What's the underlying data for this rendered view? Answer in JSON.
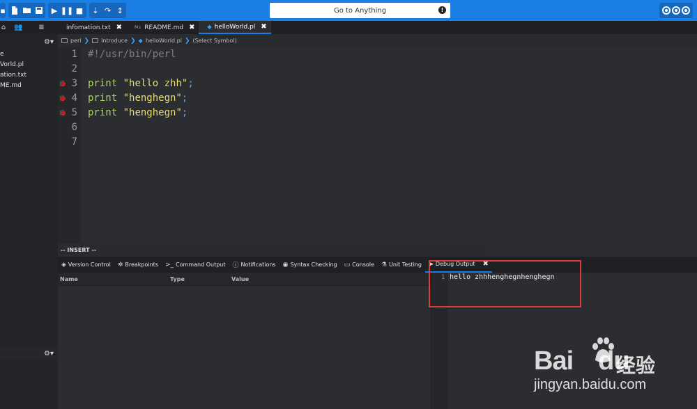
{
  "toolbar": {
    "goto_placeholder": "Go to Anything",
    "icons": [
      "new-file-icon",
      "open-folder-icon",
      "save-icon",
      "play-icon",
      "pause-icon",
      "stop-icon",
      "step-in-icon",
      "step-over-icon",
      "step-out-icon"
    ],
    "accent": "#1a7fe4"
  },
  "sidebar": {
    "tree": [
      "e",
      "Vorld.pl",
      "ation.txt",
      "ME.md"
    ]
  },
  "editor_tabs": [
    {
      "label": "infomation.txt",
      "close": "✖"
    },
    {
      "label": "README.md",
      "close": "✖",
      "badge": "M↓"
    },
    {
      "label": "helloWorld.pl",
      "close": "✖",
      "active": true
    }
  ],
  "breadcrumb": [
    "perl",
    "Introduce",
    "helloWorld.pl",
    "(Select Symbol)"
  ],
  "code": {
    "line_numbers": [
      "1",
      "2",
      "3",
      "4",
      "5",
      "6",
      "7"
    ],
    "shebang": "#!/usr/bin/perl",
    "lines": [
      {
        "kw": "print",
        "str": "\"hello zhh\"",
        "end": ";"
      },
      {
        "kw": "print",
        "str": "\"henghegn\"",
        "end": ";"
      },
      {
        "kw": "print",
        "str": "\"henghegn\"",
        "end": ";"
      }
    ]
  },
  "status": {
    "mode": "-- INSERT --"
  },
  "panel_tabs": [
    {
      "label": "Version Control",
      "icon": "version-control-icon"
    },
    {
      "label": "Breakpoints",
      "icon": "bug-icon"
    },
    {
      "label": "Command Output",
      "icon": "terminal-icon"
    },
    {
      "label": "Notifications",
      "icon": "info-icon"
    },
    {
      "label": "Syntax Checking",
      "icon": "eye-icon"
    },
    {
      "label": "Console",
      "icon": "monitor-icon"
    },
    {
      "label": "Unit Testing",
      "icon": "flask-icon"
    },
    {
      "label": "Debug Output",
      "icon": "play-icon",
      "active": true,
      "close": "✖"
    }
  ],
  "variables": {
    "headers": [
      "Name",
      "Type",
      "Value"
    ]
  },
  "output": {
    "line": "1",
    "text": "hello zhhhenghegnhenghegn"
  },
  "watermark": {
    "brand": "Bai",
    "brand2": "du",
    "cn": "经验",
    "url": "jingyan.baidu.com"
  }
}
